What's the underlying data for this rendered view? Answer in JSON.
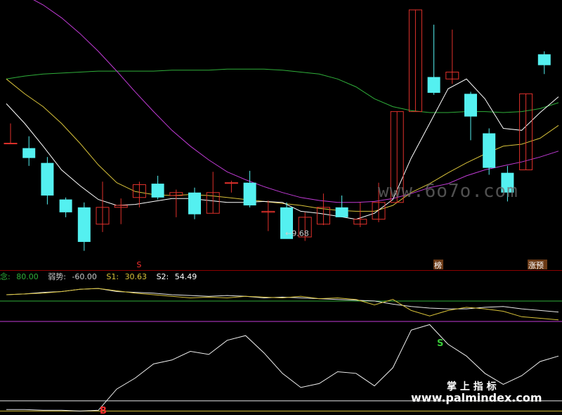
{
  "colors": {
    "background": "#000000",
    "up": "#e0312b",
    "down": "#54f0f0",
    "ma_short": "#ffffff",
    "ma_mid": "#d8c23a",
    "ma_purple": "#c13bd6",
    "ma_green": "#2fae3a",
    "divider": "#8b0000"
  },
  "watermark_main": "www.6o7o.com",
  "watermark_cn": "掌 上 指 标",
  "watermark_url": "www.palmindex.com",
  "annotations": {
    "low_label": "←9.68",
    "sell_marker_top": "S",
    "tag_1": "榜",
    "tag_2": "涨预",
    "sell_marker_bottom": "S",
    "buy_marker_bottom": "B"
  },
  "legend": [
    {
      "label": "念: ",
      "value": "80.00",
      "color": "#2fae3a"
    },
    {
      "label": "弱势: ",
      "value": "-60.00",
      "color": "#c8c8c8"
    },
    {
      "label": "S1: ",
      "value": "30.63",
      "color": "#d8c23a"
    },
    {
      "label": "S2: ",
      "value": "54.49",
      "color": "#ffffff"
    }
  ],
  "chart_data": {
    "type": "candlestick",
    "candles": [
      {
        "o": 10.55,
        "c": 10.55,
        "h": 10.75,
        "l": 10.55
      },
      {
        "o": 10.5,
        "c": 10.4,
        "h": 10.62,
        "l": 10.32
      },
      {
        "o": 10.35,
        "c": 10.02,
        "h": 10.41,
        "l": 9.93
      },
      {
        "o": 9.98,
        "c": 9.85,
        "h": 10.0,
        "l": 9.8
      },
      {
        "o": 9.9,
        "c": 9.55,
        "h": 9.95,
        "l": 9.46
      },
      {
        "o": 9.73,
        "c": 9.9,
        "h": 10.16,
        "l": 9.65
      },
      {
        "o": 9.9,
        "c": 9.92,
        "h": 9.99,
        "l": 9.73
      },
      {
        "o": 10.0,
        "c": 10.13,
        "h": 10.16,
        "l": 9.9
      },
      {
        "o": 10.14,
        "c": 10.0,
        "h": 10.22,
        "l": 9.98
      },
      {
        "o": 10.02,
        "c": 10.05,
        "h": 10.08,
        "l": 9.8
      },
      {
        "o": 10.05,
        "c": 9.83,
        "h": 10.1,
        "l": 9.78
      },
      {
        "o": 9.84,
        "c": 10.05,
        "h": 10.26,
        "l": 9.84
      },
      {
        "o": 10.15,
        "c": 10.15,
        "h": 10.17,
        "l": 10.05
      },
      {
        "o": 10.15,
        "c": 9.92,
        "h": 10.27,
        "l": 9.9
      },
      {
        "o": 9.85,
        "c": 9.86,
        "h": 9.97,
        "l": 9.66
      },
      {
        "o": 9.9,
        "c": 9.58,
        "h": 9.95,
        "l": 9.68
      },
      {
        "o": 9.6,
        "c": 9.8,
        "h": 9.85,
        "l": 9.56
      },
      {
        "o": 9.73,
        "c": 9.9,
        "h": 10.04,
        "l": 9.72
      },
      {
        "o": 9.9,
        "c": 9.8,
        "h": 10.02,
        "l": 9.8
      },
      {
        "o": 9.73,
        "c": 9.78,
        "h": 9.95,
        "l": 9.7
      },
      {
        "o": 9.78,
        "c": 9.95,
        "h": 10.15,
        "l": 9.75
      },
      {
        "o": 9.95,
        "c": 10.87,
        "h": 10.87,
        "l": 9.95
      },
      {
        "o": 10.87,
        "c": 11.9,
        "h": 11.9,
        "l": 10.87
      },
      {
        "o": 11.22,
        "c": 11.06,
        "h": 11.75,
        "l": 11.04
      },
      {
        "o": 11.2,
        "c": 11.27,
        "h": 11.7,
        "l": 11.15
      },
      {
        "o": 11.05,
        "c": 10.82,
        "h": 11.07,
        "l": 10.58
      },
      {
        "o": 10.65,
        "c": 10.3,
        "h": 10.7,
        "l": 10.23
      },
      {
        "o": 10.25,
        "c": 10.05,
        "h": 10.32,
        "l": 9.96
      },
      {
        "o": 10.28,
        "c": 11.05,
        "h": 11.05,
        "l": 10.28
      },
      {
        "o": 11.45,
        "c": 11.34,
        "h": 11.48,
        "l": 11.25
      }
    ],
    "ma_short": [
      10.95,
      10.75,
      10.52,
      10.28,
      10.12,
      9.98,
      9.92,
      9.93,
      9.96,
      9.99,
      9.99,
      9.97,
      9.95,
      9.95,
      9.96,
      9.95,
      9.86,
      9.84,
      9.81,
      9.78,
      9.84,
      9.98,
      10.4,
      10.75,
      11.1,
      11.2,
      11.0,
      10.7,
      10.68,
      10.86,
      11.02
    ],
    "ma_mid": [
      11.2,
      11.05,
      10.92,
      10.75,
      10.55,
      10.33,
      10.15,
      10.06,
      10.03,
      10.02,
      10.03,
      10.02,
      10.0,
      9.98,
      9.96,
      9.94,
      9.92,
      9.89,
      9.87,
      9.86,
      9.86,
      9.92,
      10.05,
      10.14,
      10.25,
      10.35,
      10.44,
      10.52,
      10.54,
      10.6,
      10.73
    ],
    "ma_purple": [
      12.15,
      12.05,
      11.95,
      11.82,
      11.66,
      11.48,
      11.28,
      11.07,
      10.87,
      10.68,
      10.52,
      10.38,
      10.26,
      10.18,
      10.11,
      10.05,
      10.0,
      9.97,
      9.95,
      9.95,
      9.96,
      9.99,
      10.04,
      10.1,
      10.14,
      10.22,
      10.28,
      10.32,
      10.36,
      10.41,
      10.47
    ],
    "ma_green": [
      11.2,
      11.23,
      11.25,
      11.26,
      11.27,
      11.28,
      11.28,
      11.28,
      11.28,
      11.29,
      11.29,
      11.29,
      11.3,
      11.3,
      11.3,
      11.29,
      11.27,
      11.25,
      11.2,
      11.12,
      11.0,
      10.92,
      10.88,
      10.86,
      10.86,
      10.87,
      10.87,
      10.86,
      10.87,
      10.9,
      10.96
    ],
    "low_price": 9.68,
    "ylim": [
      9.4,
      12.0
    ],
    "osc_s1": [
      88,
      89,
      90,
      92,
      95,
      96,
      93,
      90,
      88,
      86,
      84,
      85,
      84,
      86,
      85,
      84,
      86,
      83,
      84,
      82,
      75,
      82,
      68,
      61,
      68,
      72,
      70,
      67,
      60,
      58,
      56
    ],
    "osc_s2": [
      88,
      89,
      91,
      92,
      95,
      96,
      92,
      91,
      90,
      88,
      87,
      86,
      87,
      86,
      84,
      85,
      84,
      83,
      82,
      81,
      80,
      76,
      73,
      71,
      70,
      70,
      72,
      73,
      70,
      68,
      66
    ],
    "osc_strong": 80,
    "osc_weak": -60,
    "osc_range": [
      -65,
      105
    ],
    "osc_k": [
      -58,
      -58,
      -59,
      -59,
      -60,
      -59,
      -32,
      -18,
      0,
      5,
      16,
      12,
      30,
      36,
      14,
      -12,
      -30,
      -25,
      -10,
      -12,
      -28,
      -5,
      43,
      50,
      25,
      10,
      -12,
      -26,
      -15,
      3,
      10
    ]
  }
}
